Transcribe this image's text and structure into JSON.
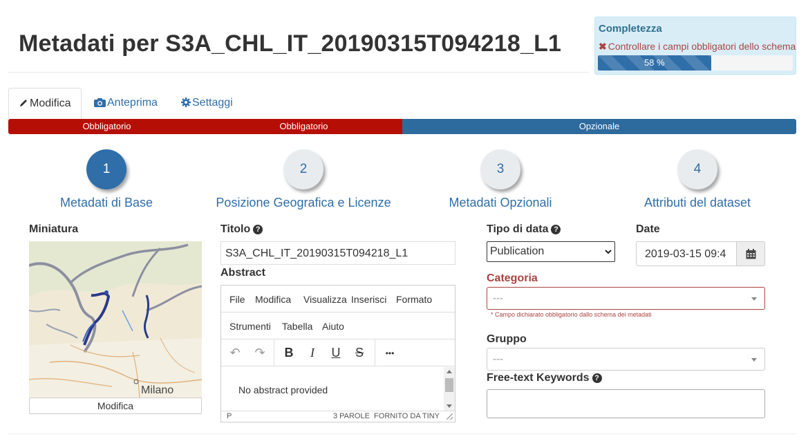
{
  "page_title": "Metadati per S3A_CHL_IT_20190315T094218_L1",
  "completeness": {
    "title": "Completezza",
    "warning_icon": "✖",
    "warning": "Controllare i campi obbligatori dello schema",
    "percent": 58,
    "percent_label": "58 %",
    "bar_color": "#2f6ea8"
  },
  "tabs": [
    {
      "label": "Modifica",
      "icon": "pencil-icon"
    },
    {
      "label": "Anteprima",
      "icon": "camera-icon"
    },
    {
      "label": "Settaggi",
      "icon": "gear-icon"
    }
  ],
  "requirement_bar": [
    {
      "label": "Obbligatorio",
      "color": "#b50f05"
    },
    {
      "label": "Obbligatorio",
      "color": "#b50f05"
    },
    {
      "label": "Opzionale",
      "color": "#2d6a9e"
    }
  ],
  "steps": [
    {
      "number": "1",
      "label": "Metadati di Base",
      "active": true
    },
    {
      "number": "2",
      "label": "Posizione Geografica e Licenze",
      "active": false
    },
    {
      "number": "3",
      "label": "Metadati Opzionali",
      "active": false
    },
    {
      "number": "4",
      "label": "Attributi del dataset",
      "active": false
    }
  ],
  "thumbnail": {
    "label": "Miniatura",
    "map_city_label": "Milano",
    "button": "Modifica"
  },
  "title_field": {
    "label": "Titolo",
    "help_icon": "question-circle-icon",
    "value": "S3A_CHL_IT_20190315T094218_L1"
  },
  "abstract": {
    "label": "Abstract",
    "menu": [
      "File",
      "Modifica",
      "Visualizza",
      "Inserisci",
      "Formato",
      "Strumenti",
      "Tabella",
      "Aiuto"
    ],
    "toolbar": {
      "undo": "↶",
      "redo": "↷",
      "bold": "B",
      "italic": "I",
      "underline": "U",
      "strike": "S",
      "more": "•••"
    },
    "content": "No abstract provided",
    "status_left": "P",
    "status_right": "3 PAROLE  FORNITO DA TINY"
  },
  "date_type": {
    "label": "Tipo di data",
    "selected": "Publication"
  },
  "date": {
    "label": "Date",
    "value": "2019-03-15 09:4",
    "icon": "calendar-icon"
  },
  "category": {
    "label": "Categoria",
    "placeholder": "---",
    "error": "* Campo dichiarato obbligatorio dallo schema dei metadati",
    "label_color": "#a94442"
  },
  "group": {
    "label": "Gruppo",
    "placeholder": "---"
  },
  "keywords": {
    "label": "Free-text Keywords",
    "value": ""
  }
}
